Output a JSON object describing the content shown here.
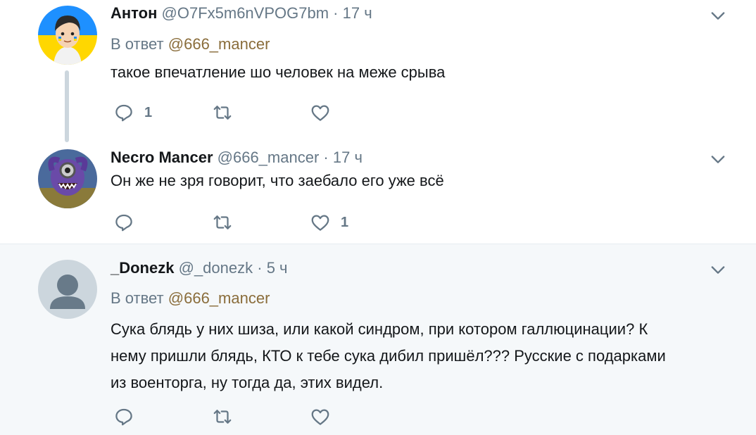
{
  "colors": {
    "text": "#14171a",
    "secondary": "#657786",
    "mention": "#8a6d3b",
    "highlight_bg": "#f5f8fa"
  },
  "tweets": [
    {
      "name": "Антон",
      "handle": "@O7Fx5m6nVPOG7bm",
      "dot": "·",
      "time": "17 ч",
      "reply_prefix": "В ответ",
      "reply_mention": "@666_mancer",
      "text": "такое впечатление шо человек  на меже срыва",
      "reply_count": "1",
      "retweet_count": "",
      "like_count": "",
      "avatar_icon": "cartoon-boy-avatar"
    },
    {
      "name": "Necro Mancer",
      "handle": "@666_mancer",
      "dot": "·",
      "time": "17 ч",
      "text": "Он же не зря говорит, что заебало его уже всё",
      "reply_count": "",
      "retweet_count": "",
      "like_count": "1",
      "avatar_icon": "monster-avatar"
    },
    {
      "name": "_Donezk",
      "handle": "@_donezk",
      "dot": "·",
      "time": "5 ч",
      "reply_prefix": "В ответ",
      "reply_mention": "@666_mancer",
      "text_lines": [
        "Сука блядь у них шиза, или какой синдром, при котором галлюцинации? К",
        "нему пришли блядь, КТО к тебе сука дибил пришёл??? Русские с подарками",
        "из военторга, ну тогда да, этих видел."
      ],
      "reply_count": "",
      "retweet_count": "",
      "like_count": "",
      "avatar_icon": "default-avatar"
    }
  ]
}
